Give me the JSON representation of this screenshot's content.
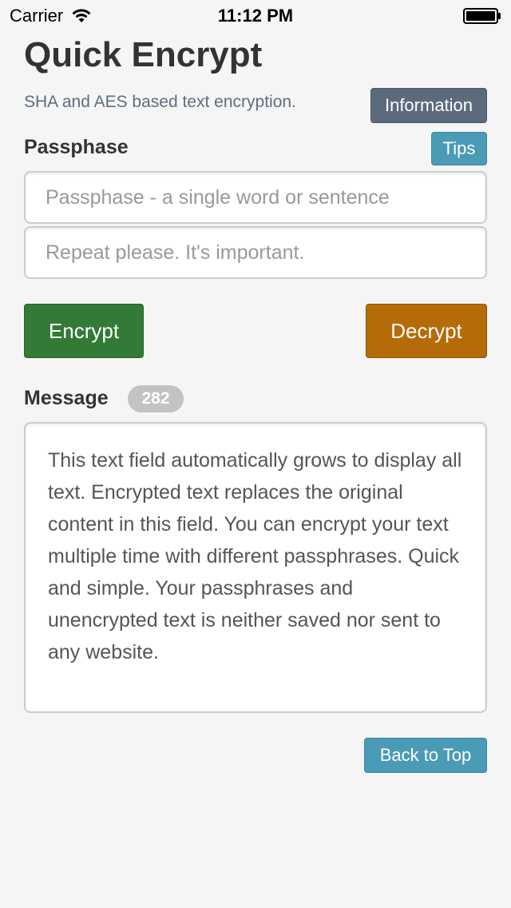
{
  "status_bar": {
    "carrier": "Carrier",
    "time": "11:12 PM",
    "wifi_icon": "wifi-icon",
    "battery_icon": "battery-icon"
  },
  "header": {
    "title": "Quick Encrypt",
    "subtitle": "SHA and AES based text encryption.",
    "info_label": "Information"
  },
  "passphrase": {
    "label": "Passphase",
    "tips_label": "Tips",
    "input_placeholder": "Passphase - a single word or sentence",
    "input_value": "",
    "repeat_placeholder": "Repeat please. It's important.",
    "repeat_value": ""
  },
  "actions": {
    "encrypt_label": "Encrypt",
    "decrypt_label": "Decrypt"
  },
  "message": {
    "label": "Message",
    "count": "282",
    "text": "This text field automatically grows to display all text. Encrypted text replaces the original content in this field. You can encrypt your text multiple time with different passphrases. Quick and simple. Your passphrases and unencrypted text is neither saved nor sent to any website."
  },
  "footer": {
    "back_to_top_label": "Back to Top"
  },
  "colors": {
    "info_button": "#5b6b7c",
    "tips_button": "#4a9bb5",
    "encrypt_button": "#337a37",
    "decrypt_button": "#b56b08",
    "badge": "#c3c3c3"
  }
}
